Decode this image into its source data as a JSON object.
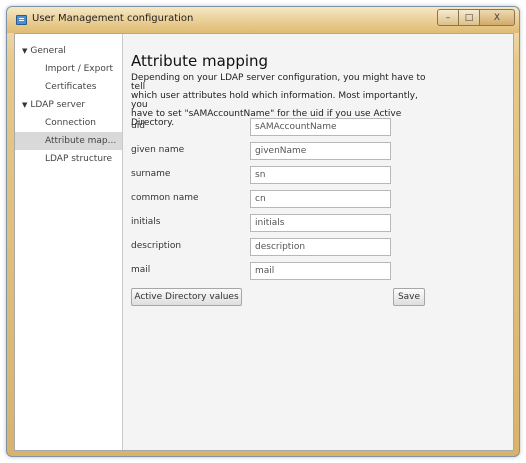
{
  "window": {
    "title": "User Management configuration",
    "controls": {
      "minimize": "–",
      "maximize": "□",
      "close": "X"
    }
  },
  "sidebar": {
    "items": [
      {
        "label": "General",
        "level": 0,
        "expanded": true
      },
      {
        "label": "Import / Export",
        "level": 1
      },
      {
        "label": "Certificates",
        "level": 1
      },
      {
        "label": "LDAP server",
        "level": 0,
        "expanded": true
      },
      {
        "label": "Connection",
        "level": 1
      },
      {
        "label": "Attribute map...",
        "level": 1,
        "selected": true
      },
      {
        "label": "LDAP structure",
        "level": 1
      }
    ],
    "expanded_arrow": "▼"
  },
  "main": {
    "title": "Attribute mapping",
    "description": [
      "Depending on your LDAP server configuration, you might have to tell",
      "which user attributes hold which information. Most importantly, you",
      "have to set \"sAMAccountName\" for the uid if you use Active Directory."
    ],
    "fields": [
      {
        "label": "uid",
        "value": "sAMAccountName"
      },
      {
        "label": "given name",
        "value": "givenName"
      },
      {
        "label": "surname",
        "value": "sn"
      },
      {
        "label": "common name",
        "value": "cn"
      },
      {
        "label": "initials",
        "value": "initials"
      },
      {
        "label": "description",
        "value": "description"
      },
      {
        "label": "mail",
        "value": "mail"
      }
    ],
    "ad_button_label": "Active Directory values",
    "save_button_label": "Save"
  }
}
